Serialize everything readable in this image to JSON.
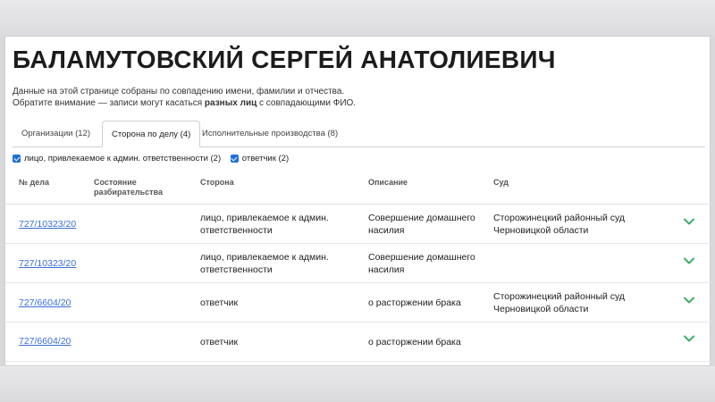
{
  "person": {
    "name": "БАЛАМУТОВСКИЙ СЕРГЕЙ АНАТОЛИЕВИЧ"
  },
  "notice": {
    "line1": "Данные на этой странице собраны по совпадению имени, фамилии и отчества.",
    "line2_prefix": "Обратите внимание — записи могут касаться ",
    "line2_bold": "разных лиц",
    "line2_suffix": " с совпадающими ФИО."
  },
  "tabs": [
    {
      "label": "Организации (12)",
      "active": false
    },
    {
      "label": "Сторона по делу (4)",
      "active": true
    },
    {
      "label": "Исполнительные производства (8)",
      "active": false
    }
  ],
  "filters": [
    {
      "label": "лицо, привлекаемое к админ. ответственности (2)",
      "checked": true
    },
    {
      "label": "ответчик (2)",
      "checked": true
    }
  ],
  "table": {
    "columns": {
      "case_no": "№ дела",
      "state_line1": "Состояние",
      "state_line2": "разбирательства",
      "party": "Сторона",
      "description": "Описание",
      "court": "Суд"
    },
    "rows": [
      {
        "case_no": "727/10323/20",
        "state": "",
        "party_line1": "лицо, привлекаемое к админ.",
        "party_line2": "ответственности",
        "desc_line1": "Совершение домашнего",
        "desc_line2": "насилия",
        "court_line1": "Сторожинецкий районный суд",
        "court_line2": "Черновицкой области"
      },
      {
        "case_no": "727/10323/20",
        "state": "",
        "party_line1": "лицо, привлекаемое к админ.",
        "party_line2": "ответственности",
        "desc_line1": "Совершение домашнего",
        "desc_line2": "насилия",
        "court_line1": "",
        "court_line2": ""
      },
      {
        "case_no": "727/6604/20",
        "state": "",
        "party_line1": "ответчик",
        "party_line2": "",
        "desc_line1": "о расторжении брака",
        "desc_line2": "",
        "court_line1": "Сторожинецкий районный суд",
        "court_line2": "Черновицкой области"
      },
      {
        "case_no": "727/6604/20",
        "state": "",
        "party_line1": "ответчик",
        "party_line2": "",
        "desc_line1": "о расторжении брака",
        "desc_line2": "",
        "court_line1": "",
        "court_line2": ""
      }
    ]
  },
  "icons": {
    "row_expand": "chevron-down-icon",
    "filter_check": "checkbox-checked-icon"
  },
  "colors": {
    "link": "#3b6fd6",
    "chevron": "#3cae6a",
    "checkbox": "#1d6fdc"
  }
}
